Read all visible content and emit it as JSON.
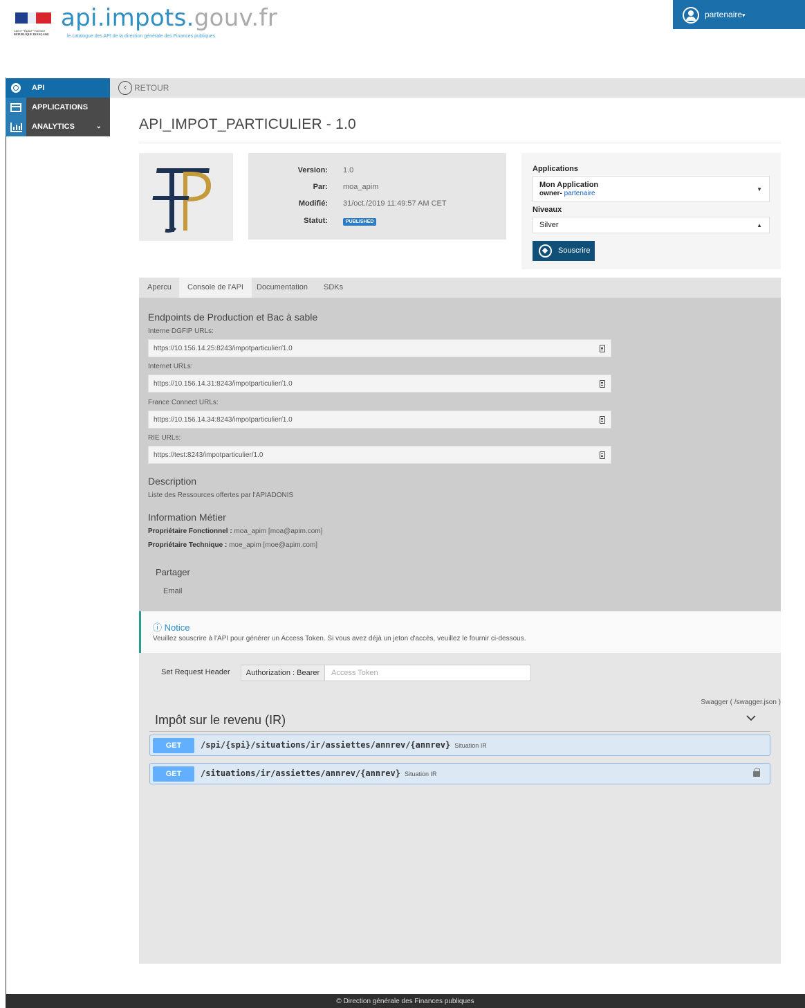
{
  "header": {
    "brand_main": "api.impots.",
    "brand_tld": "gouv.fr",
    "tagline": "le catalogue des API de la direction générale des Finances publiques",
    "republique_motto": "Liberté • Égalité • Fraternité",
    "republique_name": "RÉPUBLIQUE FRANÇAISE",
    "user": "partenaire",
    "user_caret": "▾"
  },
  "sidebar": {
    "items": [
      {
        "label": "API",
        "icon": "gear-icon"
      },
      {
        "label": "APPLICATIONS",
        "icon": "window-icon"
      },
      {
        "label": "ANALYTICS",
        "icon": "bar-chart-icon",
        "caret": "⌄"
      }
    ]
  },
  "nav": {
    "back_label": "RETOUR"
  },
  "api": {
    "title": "API_IMPOT_PARTICULIER - 1.0",
    "version_label": "Version:",
    "version": "1.0",
    "par_label": "Par:",
    "par": "moa_apim",
    "modifie_label": "Modifié:",
    "modifie": "31/oct./2019 11:49:57 AM CET",
    "statut_label": "Statut:",
    "statut": "PUBLISHED"
  },
  "subscribe": {
    "applications_label": "Applications",
    "app_name": "Mon Application",
    "app_owner_prefix": "owner-",
    "app_owner": "partenaire",
    "niveaux_label": "Niveaux",
    "niveau": "Silver",
    "button": "Souscrire"
  },
  "tabs": [
    "Apercu",
    "Console de l'API",
    "Documentation",
    "SDKs"
  ],
  "console": {
    "endpoints_title": "Endpoints de Production et Bac à sable",
    "endpoints": [
      {
        "label": "Interne DGFIP URLs:",
        "url": "https://10.156.14.25:8243/impotparticulier/1.0"
      },
      {
        "label": "Internet URLs:",
        "url": "https://10.156.14.31:8243/impotparticulier/1.0"
      },
      {
        "label": "France Connect URLs:",
        "url": "https://10.156.14.34:8243/impotparticulier/1.0"
      },
      {
        "label": "RIE URLs:",
        "url": "https://test:8243/impotparticulier/1.0"
      }
    ],
    "description_title": "Description",
    "description": "Liste des Ressources offertes par l'APIADONIS",
    "info_title": "Information Métier",
    "proprio_fonc_label": "Propriétaire Fonctionnel :",
    "proprio_fonc": "moa_apim [moa@apim.com]",
    "proprio_tech_label": "Propriétaire Technique :",
    "proprio_tech": "moe_apim [moe@apim.com]",
    "partager_title": "Partager",
    "partager_email": "Email"
  },
  "notice": {
    "title": "Notice",
    "body": "Veuillez souscrire à l'API pour générer un Access Token. Si vous avez déjà un jeton d'accès, veuillez le fournir ci-dessous."
  },
  "request": {
    "set_header_label": "Set Request Header",
    "auth_label": "Authorization : Bearer",
    "token_placeholder": "Access Token"
  },
  "swagger": {
    "link": "Swagger ( /swagger.json )",
    "section_title": "Impôt sur le revenu (IR)",
    "operations": [
      {
        "method": "GET",
        "path": "/spi/{spi}/situations/ir/assiettes/annrev/{annrev}",
        "summary": "Situation IR",
        "locked": false
      },
      {
        "method": "GET",
        "path": "/situations/ir/assiettes/annrev/{annrev}",
        "summary": "Situation IR",
        "locked": true
      }
    ]
  },
  "footer": {
    "text": "© Direction générale des Finances publiques"
  },
  "colors": {
    "brand": "#2e8fc5",
    "nav_active": "#136ca7",
    "subscribe_button": "#0f4f78",
    "get_method": "#61affe",
    "notice_border": "#2a9d8f"
  }
}
